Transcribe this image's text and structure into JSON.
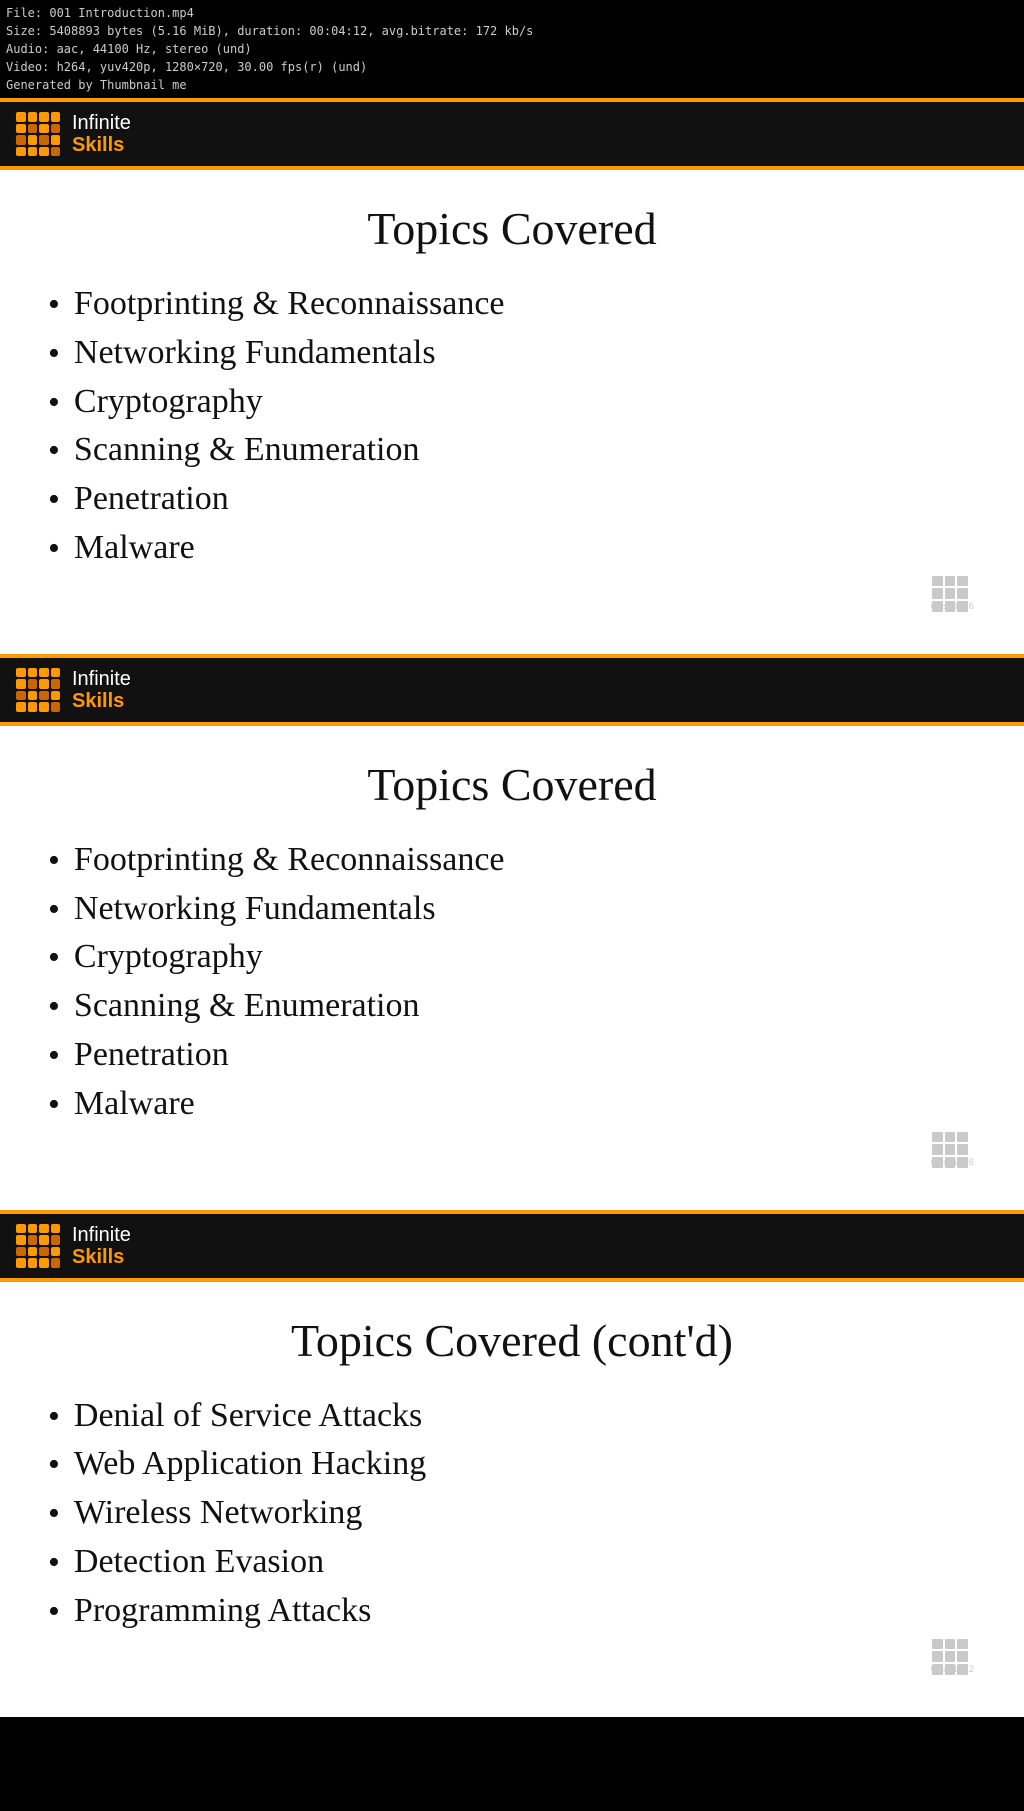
{
  "meta": {
    "line1": "File: 001 Introduction.mp4",
    "line2": "Size: 5408893 bytes (5.16 MiB), duration: 00:04:12, avg.bitrate: 172 kb/s",
    "line3": "Audio: aac, 44100 Hz, stereo (und)",
    "line4": "Video: h264, yuv420p, 1280×720, 30.00 fps(r) (und)",
    "line5": "Generated by Thumbnail me"
  },
  "logo": {
    "text_infinite": "Infinite",
    "text_skills": "Skills"
  },
  "slides": [
    {
      "title": "Topics Covered",
      "timecode": "00:00:56",
      "items": [
        "Footprinting & Reconnaissance",
        "Networking Fundamentals",
        "Cryptography",
        "Scanning & Enumeration",
        "Penetration",
        "Malware"
      ]
    },
    {
      "title": "Topics Covered",
      "timecode": "00:01:40",
      "items": [
        "Footprinting & Reconnaissance",
        "Networking Fundamentals",
        "Cryptography",
        "Scanning & Enumeration",
        "Penetration",
        "Malware"
      ]
    },
    {
      "title": "Topics Covered (cont'd)",
      "timecode": "00:01:52",
      "items": [
        "Denial of Service Attacks",
        "Web Application Hacking",
        "Wireless Networking",
        "Detection Evasion",
        "Programming Attacks"
      ]
    }
  ],
  "logo_colors": {
    "orange": "#f90",
    "dark_orange": "#c60",
    "light_orange": "#ffa040",
    "very_light": "#ffcc80"
  }
}
